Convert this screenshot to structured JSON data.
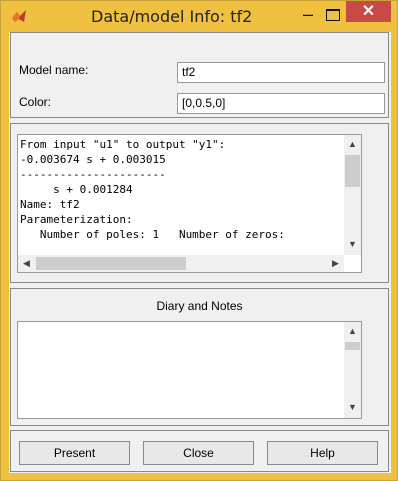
{
  "window": {
    "title": "Data/model Info: tf2",
    "minimize_glyph": "–",
    "close_glyph": "✕",
    "app_icon": "matlab-icon",
    "accent_color": "#f0c040",
    "close_color": "#c74a46"
  },
  "fields": {
    "model_name_label": "Model name:",
    "model_name_value": "tf2",
    "color_label": "Color:",
    "color_value": "[0,0.5,0]"
  },
  "info_lines": [
    "From input \"u1\" to output \"y1\":",
    "-0.003674 s + 0.003015",
    "----------------------",
    "     s + 0.001284",
    "Name: tf2",
    "Parameterization:",
    "   Number of poles: 1   Number of zeros:"
  ],
  "diary": {
    "title": "Diary and Notes",
    "text": ""
  },
  "buttons": {
    "present": "Present",
    "close": "Close",
    "help": "Help"
  }
}
